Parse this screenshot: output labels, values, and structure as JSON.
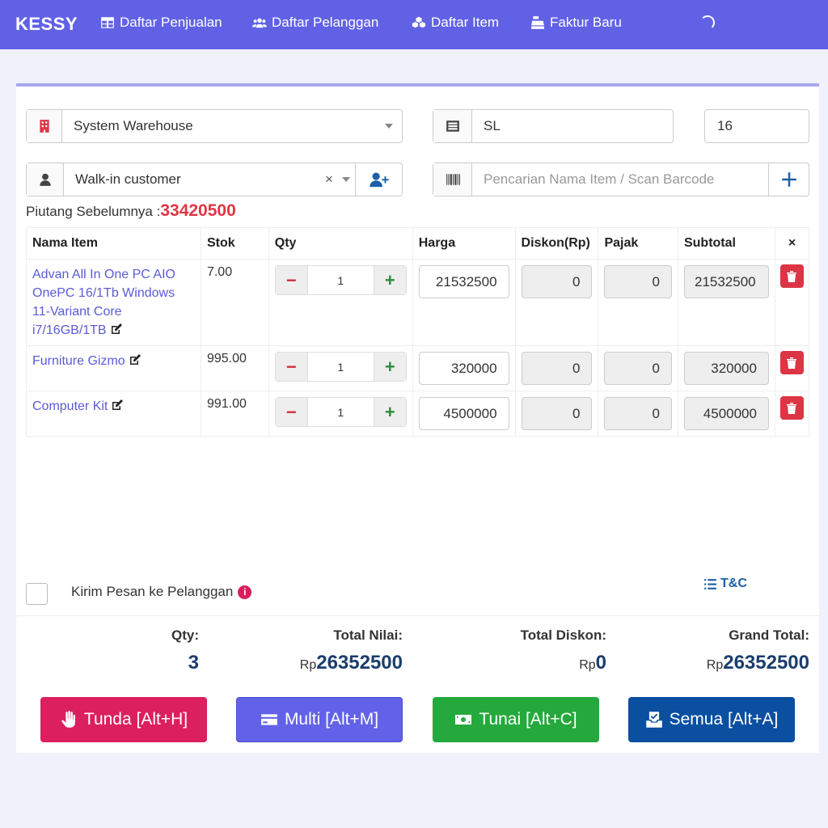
{
  "navbar": {
    "brand": "KESSY",
    "links": [
      {
        "label": "Daftar Penjualan",
        "icon": "table-icon"
      },
      {
        "label": "Daftar Pelanggan",
        "icon": "users-icon"
      },
      {
        "label": "Daftar Item",
        "icon": "cubes-icon"
      },
      {
        "label": "Faktur Baru",
        "icon": "cash-register-icon"
      }
    ]
  },
  "form": {
    "warehouse": "System Warehouse",
    "invoice_prefix": "SL",
    "invoice_number": "16",
    "customer": "Walk-in customer",
    "search_placeholder": "Pencarian Nama Item  / Scan Barcode",
    "clear_symbol": "×"
  },
  "piutang": {
    "label": "Piutang Sebelumnya :",
    "value": "33420500"
  },
  "table": {
    "headers": [
      "Nama Item",
      "Stok",
      "Qty",
      "Harga",
      "Diskon(Rp)",
      "Pajak",
      "Subtotal",
      "×"
    ],
    "rows": [
      {
        "name": "Advan All In One PC AIO OnePC 16/1Tb Windows 11-Variant Core i7/16GB/1TB",
        "stock": "7.00",
        "qty": "1",
        "price": "21532500",
        "discount": "0",
        "tax": "0",
        "subtotal": "21532500"
      },
      {
        "name": "Furniture Gizmo",
        "stock": "995.00",
        "qty": "1",
        "price": "320000",
        "discount": "0",
        "tax": "0",
        "subtotal": "320000"
      },
      {
        "name": "Computer Kit",
        "stock": "991.00",
        "qty": "1",
        "price": "4500000",
        "discount": "0",
        "tax": "0",
        "subtotal": "4500000"
      }
    ]
  },
  "footer": {
    "send_message_label": "Kirim Pesan ke Pelanggan",
    "info_symbol": "i",
    "tnc_label": "T&C"
  },
  "summary": {
    "qty_label": "Qty:",
    "qty_value": "3",
    "total_label": "Total Nilai:",
    "total_value": "26352500",
    "discount_label": "Total Diskon:",
    "discount_value": "0",
    "grand_label": "Grand Total:",
    "grand_value": "26352500",
    "currency": "Rp"
  },
  "actions": {
    "hold": "Tunda [Alt+H]",
    "multi": "Multi [Alt+M]",
    "cash": "Tunai [Alt+C]",
    "all": "Semua [Alt+A]"
  },
  "colors": {
    "navbar": "#6161e6",
    "hold": "#dc1f5f",
    "multi": "#6262e8",
    "cash": "#25a93d",
    "all": "#0a4fa0",
    "danger": "#dc3545"
  }
}
